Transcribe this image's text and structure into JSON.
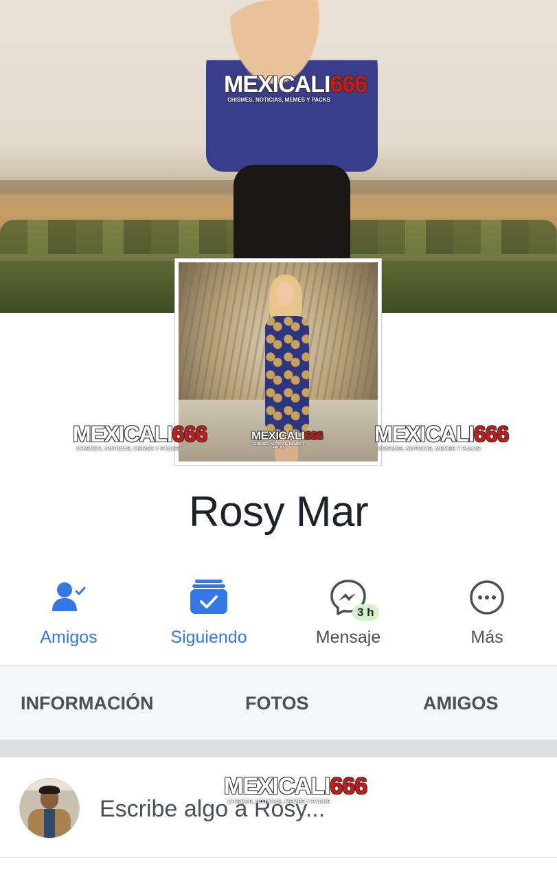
{
  "profile": {
    "name": "Rosy Mar"
  },
  "watermark": {
    "brand": "MEXICALI",
    "number": "666",
    "tagline": "CHISMES, NOTICIAS, MEMES Y PACKS"
  },
  "actions": [
    {
      "label": "Amigos",
      "icon": "friends-check-icon",
      "color": "#3578e5"
    },
    {
      "label": "Siguiendo",
      "icon": "following-check-icon",
      "color": "#3578e5"
    },
    {
      "label": "Mensaje",
      "icon": "messenger-icon",
      "badge": "3 h",
      "color": "#4b4f56"
    },
    {
      "label": "Más",
      "icon": "more-dots-icon",
      "color": "#4b4f56"
    }
  ],
  "tabs": [
    {
      "label": "INFORMACIÓN"
    },
    {
      "label": "FOTOS"
    },
    {
      "label": "AMIGOS"
    }
  ],
  "composer": {
    "placeholder": "Escribe algo a Rosy..."
  },
  "colors": {
    "accent": "#3578e5",
    "text_primary": "#1d2129",
    "text_secondary": "#4b4f56",
    "tabs_bg": "#f5f6f7",
    "badge_bg": "#d6f2cd"
  }
}
